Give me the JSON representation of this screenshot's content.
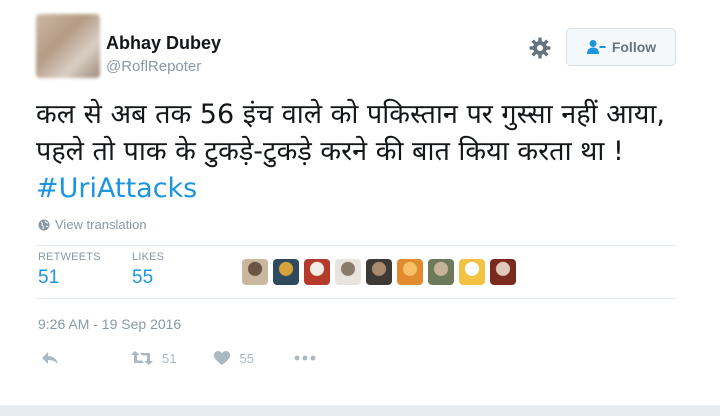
{
  "tweet": {
    "author_name": "Abhay Dubey",
    "author_handle": "@RoflRepoter",
    "text_main": "कल से अब तक 56 इंच वाले को पकिस्तान पर गुस्सा नहीं आया, पहले तो पाक के टुकड़े-टुकड़े करने की बात किया करता था ! ",
    "hashtag": "#UriAttacks",
    "translate_label": "View translation",
    "timestamp": "9:26 AM - 19 Sep 2016"
  },
  "header": {
    "follow_label": "Follow",
    "settings_icon": "gear-icon",
    "follow_icon": "add-person-icon"
  },
  "stats": {
    "retweets_label": "RETWEETS",
    "retweets_count": "51",
    "likes_label": "LIKES",
    "likes_count": "55"
  },
  "liker_avatars": [
    {
      "colors": [
        "#c9b7a0",
        "#6b5444"
      ]
    },
    {
      "colors": [
        "#2e4a5f",
        "#d6a23a"
      ]
    },
    {
      "colors": [
        "#b43b2c",
        "#f0ece6"
      ]
    },
    {
      "colors": [
        "#e7e3dd",
        "#8a7a6b"
      ]
    },
    {
      "colors": [
        "#3d3a35",
        "#a88a6e"
      ]
    },
    {
      "colors": [
        "#e08b2d",
        "#f5c067"
      ]
    },
    {
      "colors": [
        "#6c7a5a",
        "#c7b498"
      ]
    },
    {
      "colors": [
        "#f3c242",
        "#ffffff"
      ]
    },
    {
      "colors": [
        "#7a2a1f",
        "#e0cbb8"
      ]
    }
  ],
  "actions": {
    "reply_icon": "reply-icon",
    "retweet_icon": "retweet-icon",
    "retweet_count": "51",
    "like_icon": "heart-icon",
    "like_count": "55",
    "more_icon": "more-icon"
  },
  "colors": {
    "accent": "#1b95e0",
    "muted": "#8899a6",
    "icon_muted": "#aab8c2"
  }
}
